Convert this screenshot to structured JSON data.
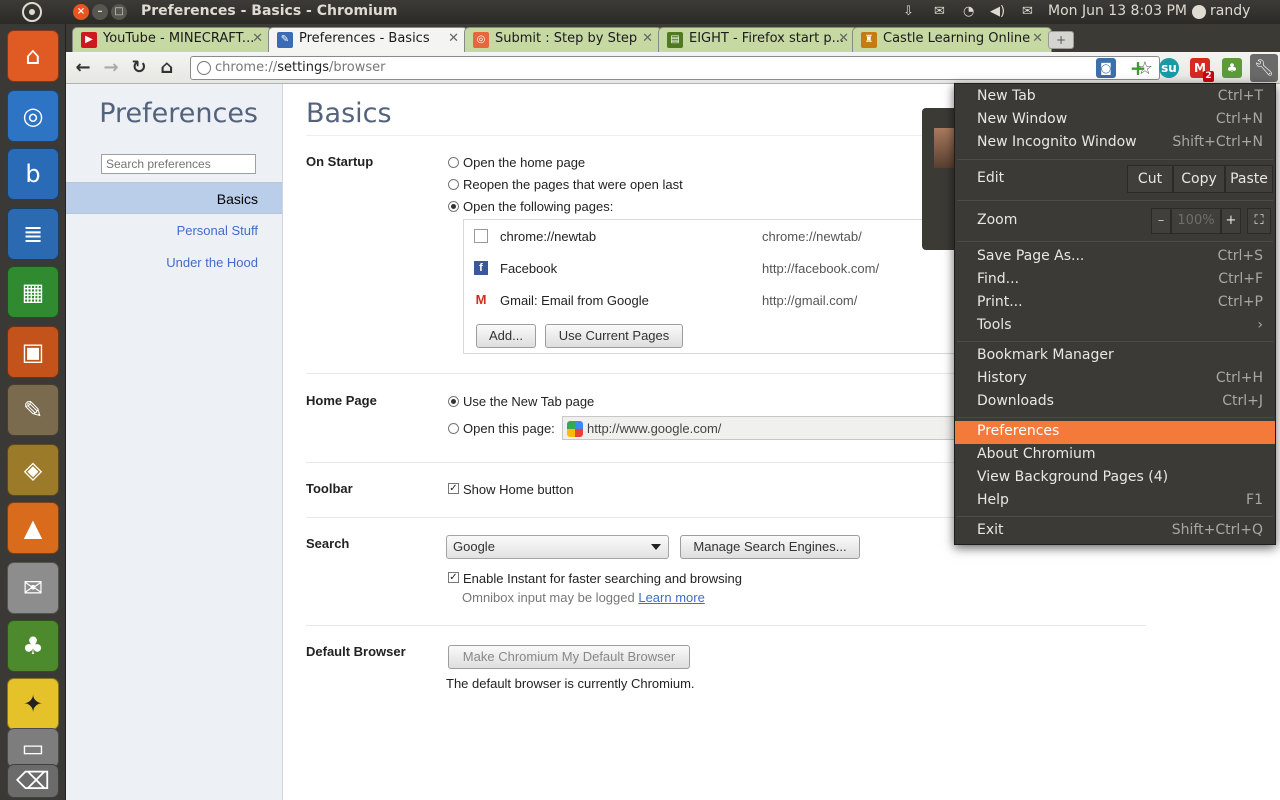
{
  "top_panel": {
    "window_title": "Preferences - Basics - Chromium",
    "clock": "Mon Jun 13  8:03 PM",
    "user": "randy"
  },
  "tabs": [
    {
      "label": "YouTube - MINECRAFT...",
      "favicon": "youtube-favicon",
      "color": "#cc181e",
      "active": false
    },
    {
      "label": "Preferences - Basics",
      "favicon": "wrench-favicon",
      "color": "#3b6bb5",
      "active": true
    },
    {
      "label": "Submit : Step by Step",
      "favicon": "submit-favicon",
      "color": "#e8663d",
      "active": false
    },
    {
      "label": "EIGHT - Firefox start p...",
      "favicon": "page-favicon",
      "color": "#4f7a21",
      "active": false
    },
    {
      "label": "Castle Learning Online",
      "favicon": "castle-favicon",
      "color": "#c57a12",
      "active": false
    }
  ],
  "omnibox": {
    "scheme": "chrome://",
    "host": "settings",
    "path": "/browser"
  },
  "extensions": {
    "badge_count": "2"
  },
  "sidebar": {
    "title": "Preferences",
    "search_placeholder": "Search preferences",
    "items": [
      {
        "label": "Basics",
        "selected": true
      },
      {
        "label": "Personal Stuff",
        "selected": false
      },
      {
        "label": "Under the Hood",
        "selected": false
      }
    ]
  },
  "main": {
    "heading": "Basics",
    "startup": {
      "title": "On Startup",
      "options": [
        "Open the home page",
        "Reopen the pages that were open last",
        "Open the following pages:"
      ],
      "selected_index": 2,
      "pages": [
        {
          "title": "chrome://newtab",
          "url": "chrome://newtab/",
          "icon": "page-icon"
        },
        {
          "title": "Facebook",
          "url": "http://facebook.com/",
          "icon": "facebook-icon"
        },
        {
          "title": "Gmail: Email from Google",
          "url": "http://gmail.com/",
          "icon": "gmail-icon"
        }
      ],
      "add_button": "Add...",
      "use_current_button": "Use Current Pages"
    },
    "home_page": {
      "title": "Home Page",
      "option_newtab": "Use the New Tab page",
      "option_open": "Open this page:",
      "url": "http://www.google.com/"
    },
    "toolbar_section": {
      "title": "Toolbar",
      "show_home": "Show Home button"
    },
    "search": {
      "title": "Search",
      "engine": "Google",
      "manage_button": "Manage Search Engines...",
      "instant_label": "Enable Instant for faster searching and browsing",
      "omnibox_note": "Omnibox input may be logged",
      "learn_more": "Learn more"
    },
    "default_browser": {
      "title": "Default Browser",
      "button": "Make Chromium My Default Browser",
      "status": "The default browser is currently Chromium."
    }
  },
  "wrench_menu": {
    "new_tab": {
      "label": "New Tab",
      "accel": "Ctrl+T"
    },
    "new_window": {
      "label": "New Window",
      "accel": "Ctrl+N"
    },
    "new_incognito": {
      "label": "New Incognito Window",
      "accel": "Shift+Ctrl+N"
    },
    "edit": {
      "label": "Edit",
      "cut": "Cut",
      "copy": "Copy",
      "paste": "Paste"
    },
    "zoom": {
      "label": "Zoom",
      "minus": "–",
      "level": "100%",
      "plus": "+"
    },
    "save_page": {
      "label": "Save Page As...",
      "accel": "Ctrl+S"
    },
    "find": {
      "label": "Find...",
      "accel": "Ctrl+F"
    },
    "print": {
      "label": "Print...",
      "accel": "Ctrl+P"
    },
    "tools": {
      "label": "Tools",
      "accel": "›"
    },
    "bookmark_manager": {
      "label": "Bookmark Manager",
      "accel": ""
    },
    "history": {
      "label": "History",
      "accel": "Ctrl+H"
    },
    "downloads": {
      "label": "Downloads",
      "accel": "Ctrl+J"
    },
    "preferences": {
      "label": "Preferences",
      "accel": ""
    },
    "about": {
      "label": "About Chromium",
      "accel": ""
    },
    "background_pages": {
      "label": "View Background Pages (4)",
      "accel": ""
    },
    "help": {
      "label": "Help",
      "accel": "F1"
    },
    "exit": {
      "label": "Exit",
      "accel": "Shift+Ctrl+Q"
    }
  },
  "colors": {
    "accent": "#f47a3c",
    "link": "#426dc9",
    "heading": "#53637d",
    "nav_selected": "#bbcee9"
  }
}
